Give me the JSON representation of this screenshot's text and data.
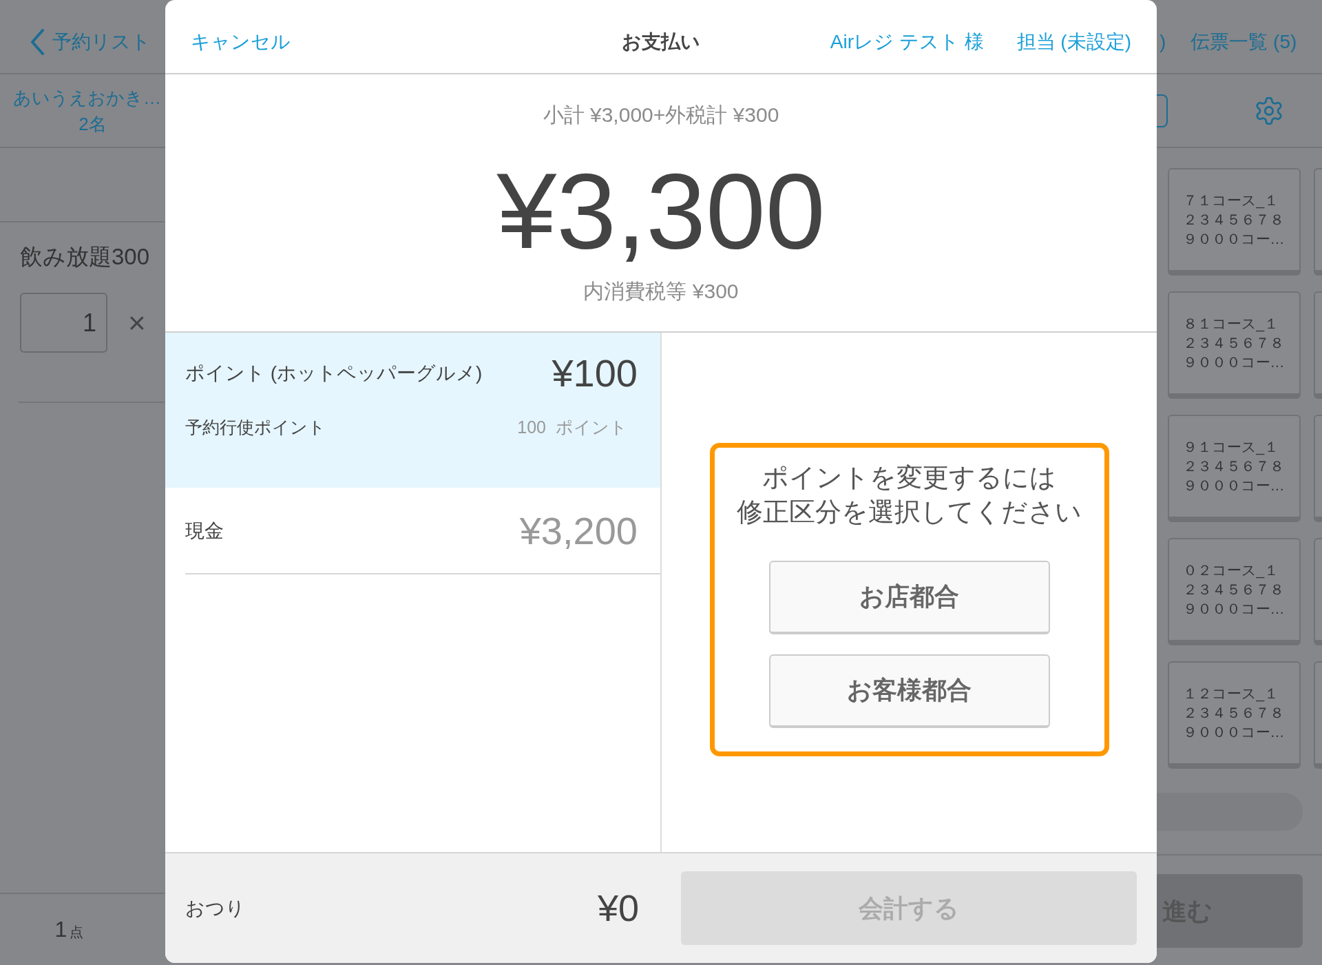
{
  "background": {
    "nav": {
      "back_link": "予約リスト",
      "partial_link": ")",
      "slips_link": "伝票一覧 (5)"
    },
    "customer": {
      "name": "あいうえおかき…",
      "party_size": "2名"
    },
    "order_item": {
      "name": "飲み放題300",
      "quantity": "1",
      "times_sign": "×"
    },
    "item_count": {
      "number": "1",
      "unit": "点"
    },
    "course_tiles": [
      {
        "label": "７１コース_１２３４５６７８９０００コー…"
      },
      {
        "label": "８１コース_１２３４５６７８９０００コー…"
      },
      {
        "label": "９１コース_１２３４５６７８９０００コー…"
      },
      {
        "label": "０２コース_１２３４５６７８９０００コー…"
      },
      {
        "label": "１２コース_１２３４５６７８９０００コー…"
      }
    ],
    "next_button": "進む"
  },
  "dialog": {
    "header": {
      "cancel": "キャンセル",
      "title": "お支払い",
      "customer": "Airレジ テスト 様",
      "staff": "担当 (未設定)"
    },
    "summary": {
      "breakdown": "小計 ¥3,000+外税計 ¥300",
      "total": "¥3,300",
      "tax_note": "内消費税等 ¥300"
    },
    "payments": [
      {
        "kind": "points",
        "label": "ポイント (ホットペッパーグルメ)",
        "amount": "¥100",
        "selected": true,
        "detail_label": "予約行使ポイント",
        "detail_value": "100",
        "detail_unit": "ポイント"
      },
      {
        "kind": "cash",
        "label": "現金",
        "amount": "¥3,200",
        "selected": false
      }
    ],
    "notice": {
      "message_lines": [
        "ポイントを変更するには",
        "修正区分を選択してください"
      ],
      "highlighted": true,
      "options": [
        "お店都合",
        "お客様都合"
      ]
    },
    "footer": {
      "change_label": "おつり",
      "change_amount": "¥0",
      "checkout_button": {
        "label": "会計する",
        "disabled": true
      }
    }
  }
}
